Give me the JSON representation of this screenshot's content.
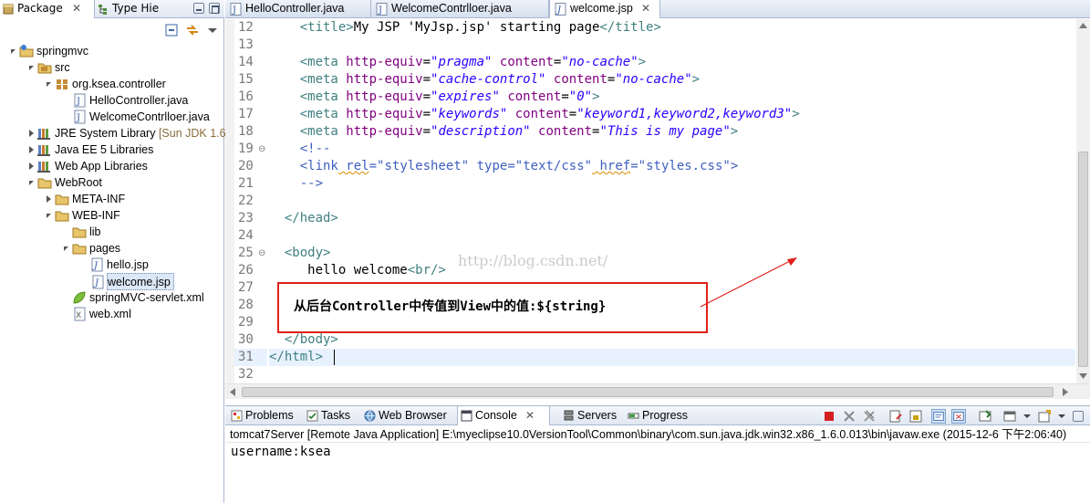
{
  "left_panel": {
    "tabs": [
      {
        "label": "Package",
        "close": "✕"
      },
      {
        "label": "Type Hie"
      }
    ],
    "tree": [
      {
        "label": "springmvc"
      },
      {
        "label": "src"
      },
      {
        "label": "org.ksea.controller"
      },
      {
        "label": "HelloController.java"
      },
      {
        "label": "WelcomeContrlloer.java"
      },
      {
        "label": "JRE System Library",
        "suffix": "[Sun JDK 1.6"
      },
      {
        "label": "Java EE 5 Libraries"
      },
      {
        "label": "Web App Libraries"
      },
      {
        "label": "WebRoot"
      },
      {
        "label": "META-INF"
      },
      {
        "label": "WEB-INF"
      },
      {
        "label": "lib"
      },
      {
        "label": "pages"
      },
      {
        "label": "hello.jsp"
      },
      {
        "label": "welcome.jsp"
      },
      {
        "label": "springMVC-servlet.xml"
      },
      {
        "label": "web.xml"
      }
    ]
  },
  "editor": {
    "tabs": [
      {
        "label": "HelloController.java"
      },
      {
        "label": "WelcomeContrlloer.java"
      },
      {
        "label": "welcome.jsp",
        "close": "✕"
      }
    ],
    "line_numbers": [
      "12",
      "13",
      "14",
      "15",
      "16",
      "17",
      "18",
      "19",
      "20",
      "21",
      "22",
      "23",
      "24",
      "25",
      "26",
      "27",
      "28",
      "29",
      "30",
      "31",
      "32"
    ],
    "lines": {
      "l12": {
        "indent": "    ",
        "open": "<title>",
        "text": "My JSP 'MyJsp.jsp' starting page",
        "close": "</title>"
      },
      "l14": {
        "indent": "    ",
        "tag": "<meta",
        "a1": " http-equiv",
        "eq1": "=",
        "v1": "\"pragma\"",
        "a2": " content",
        "eq2": "=",
        "v2": "\"no-cache\"",
        "end": ">"
      },
      "l15": {
        "indent": "    ",
        "tag": "<meta",
        "a1": " http-equiv",
        "eq1": "=",
        "v1": "\"cache-control\"",
        "a2": " content",
        "eq2": "=",
        "v2": "\"no-cache\"",
        "end": ">"
      },
      "l16": {
        "indent": "    ",
        "tag": "<meta",
        "a1": " http-equiv",
        "eq1": "=",
        "v1": "\"expires\"",
        "a2": " content",
        "eq2": "=",
        "v2": "\"0\"",
        "end": ">"
      },
      "l17": {
        "indent": "    ",
        "tag": "<meta",
        "a1": " http-equiv",
        "eq1": "=",
        "v1": "\"keywords\"",
        "a2": " content",
        "eq2": "=",
        "v2": "\"keyword1,keyword2,keyword3\"",
        "end": ">"
      },
      "l18": {
        "indent": "    ",
        "tag": "<meta",
        "a1": " http-equiv",
        "eq1": "=",
        "v1": "\"description\"",
        "a2": " content",
        "eq2": "=",
        "v2": "\"This is my page\"",
        "end": ">"
      },
      "l19": {
        "indent": "    ",
        "text": "<!--"
      },
      "l20": {
        "indent": "    ",
        "tag": "<link",
        "a1": " rel",
        "eq1": "=",
        "v1": "\"stylesheet\"",
        "a2": " type",
        "eq2": "=",
        "v2": "\"text/css\"",
        "a3": " href",
        "eq3": "=",
        "v3": "\"styles.css\"",
        "end": ">"
      },
      "l21": {
        "indent": "    ",
        "text": "-->"
      },
      "l23": {
        "indent": "  ",
        "text": "</head>"
      },
      "l25": {
        "indent": "  ",
        "text": "<body>"
      },
      "l26": {
        "indent": "     ",
        "text": "hello welcome",
        "tag": "<br/>"
      },
      "l30": {
        "indent": "  ",
        "text": "</body>"
      },
      "l31": {
        "indent": "",
        "text": "</html>"
      }
    },
    "annotation_text": "从后台Controller中传值到View中的值:${string}",
    "watermark": "http://blog.csdn.net/"
  },
  "console": {
    "tabs": [
      {
        "label": "Problems"
      },
      {
        "label": "Tasks"
      },
      {
        "label": "Web Browser"
      },
      {
        "label": "Console",
        "close": "✕"
      },
      {
        "label": "Servers"
      },
      {
        "label": "Progress"
      }
    ],
    "description": "tomcat7Server [Remote Java Application] E:\\myeclipse10.0VersionTool\\Common\\binary\\com.sun.java.jdk.win32.x86_1.6.0.013\\bin\\javaw.exe (2015-12-6 下午2:06:40)",
    "output": "username:ksea"
  },
  "colors": {
    "tag": "#3f7f7f",
    "attribute": "#7f007f",
    "attribute_value": "#2a00ff",
    "comment": "#3f5fbf",
    "annotation_border": "#e0201a"
  }
}
